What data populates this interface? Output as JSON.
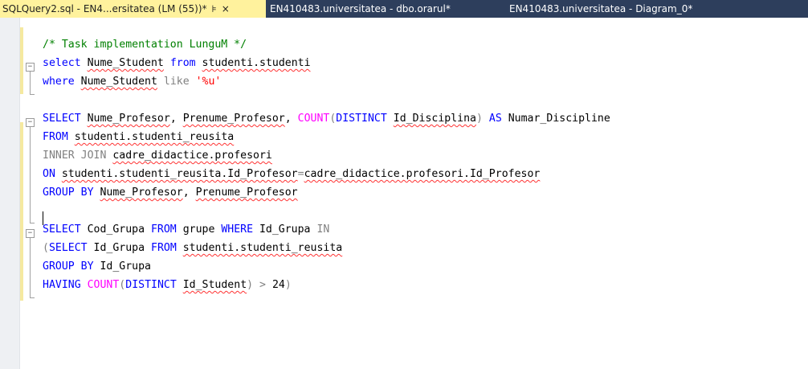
{
  "tabs": [
    {
      "label": "SQLQuery2.sql - EN4...ersitatea (LM (55))*",
      "pin": "⊧",
      "close": "×",
      "active": true
    },
    {
      "label": "EN410483.universitatea - dbo.orarul*",
      "active": false
    },
    {
      "label": "EN410483.universitatea - Diagram_0*",
      "active": false
    }
  ],
  "colors": {
    "keyword": "#0000ff",
    "function": "#ff00ff",
    "comment": "#008000",
    "string": "#ff0000",
    "operator": "#808080",
    "active_tab": "#fff29d",
    "tab_bar": "#2d3e5c"
  },
  "editor": {
    "lines": [
      [
        {
          "t": "/* Task implementation LunguM */",
          "c": "cm"
        }
      ],
      [
        {
          "t": "select",
          "c": "kw"
        },
        {
          "t": " "
        },
        {
          "t": "Nume_Student",
          "s": true
        },
        {
          "t": " "
        },
        {
          "t": "from",
          "c": "kw"
        },
        {
          "t": " "
        },
        {
          "t": "studenti.studenti",
          "s": true
        }
      ],
      [
        {
          "t": "where",
          "c": "kw"
        },
        {
          "t": " "
        },
        {
          "t": "Nume_Student",
          "s": true
        },
        {
          "t": " "
        },
        {
          "t": "like",
          "c": "op"
        },
        {
          "t": " "
        },
        {
          "t": "'%u'",
          "c": "st"
        }
      ],
      [],
      [
        {
          "t": "SELECT",
          "c": "kw"
        },
        {
          "t": " "
        },
        {
          "t": "Nume_Profesor",
          "s": true
        },
        {
          "t": ", "
        },
        {
          "t": "Prenume_Profesor",
          "s": true
        },
        {
          "t": ", "
        },
        {
          "t": "COUNT",
          "c": "fn"
        },
        {
          "t": "(",
          "c": "op"
        },
        {
          "t": "DISTINCT",
          "c": "kw"
        },
        {
          "t": " "
        },
        {
          "t": "Id_Disciplina",
          "s": true
        },
        {
          "t": ")",
          "c": "op"
        },
        {
          "t": " "
        },
        {
          "t": "AS",
          "c": "kw"
        },
        {
          "t": " Numar_Discipline"
        }
      ],
      [
        {
          "t": "FROM",
          "c": "kw"
        },
        {
          "t": " "
        },
        {
          "t": "studenti.studenti_reusita",
          "s": true
        }
      ],
      [
        {
          "t": "INNER JOIN",
          "c": "op"
        },
        {
          "t": " "
        },
        {
          "t": "cadre_didactice.profesori",
          "s": true
        }
      ],
      [
        {
          "t": "ON",
          "c": "kw"
        },
        {
          "t": " "
        },
        {
          "t": "studenti.studenti_reusita.Id_Profesor",
          "s": true
        },
        {
          "t": "=",
          "c": "op"
        },
        {
          "t": "cadre_didactice.profesori.Id_Profesor",
          "s": true
        }
      ],
      [
        {
          "t": "GROUP BY",
          "c": "kw"
        },
        {
          "t": " "
        },
        {
          "t": "Nume_Profesor",
          "s": true
        },
        {
          "t": ", "
        },
        {
          "t": "Prenume_Profesor",
          "s": true
        }
      ],
      [],
      [
        {
          "t": "SELECT",
          "c": "kw"
        },
        {
          "t": " Cod_Grupa "
        },
        {
          "t": "FROM",
          "c": "kw"
        },
        {
          "t": " grupe "
        },
        {
          "t": "WHERE",
          "c": "kw"
        },
        {
          "t": " Id_Grupa "
        },
        {
          "t": "IN",
          "c": "op"
        }
      ],
      [
        {
          "t": "(",
          "c": "op"
        },
        {
          "t": "SELECT",
          "c": "kw"
        },
        {
          "t": " Id_Grupa "
        },
        {
          "t": "FROM",
          "c": "kw"
        },
        {
          "t": " "
        },
        {
          "t": "studenti.studenti_reusita",
          "s": true
        }
      ],
      [
        {
          "t": "GROUP BY",
          "c": "kw"
        },
        {
          "t": " Id_Grupa"
        }
      ],
      [
        {
          "t": "HAVING",
          "c": "kw"
        },
        {
          "t": " "
        },
        {
          "t": "COUNT",
          "c": "fn"
        },
        {
          "t": "(",
          "c": "op"
        },
        {
          "t": "DISTINCT",
          "c": "kw"
        },
        {
          "t": " "
        },
        {
          "t": "Id_Student",
          "s": true
        },
        {
          "t": ")",
          "c": "op"
        },
        {
          "t": " "
        },
        {
          "t": ">",
          "c": "op"
        },
        {
          "t": " 24"
        },
        {
          "t": ")",
          "c": "op"
        }
      ]
    ]
  }
}
